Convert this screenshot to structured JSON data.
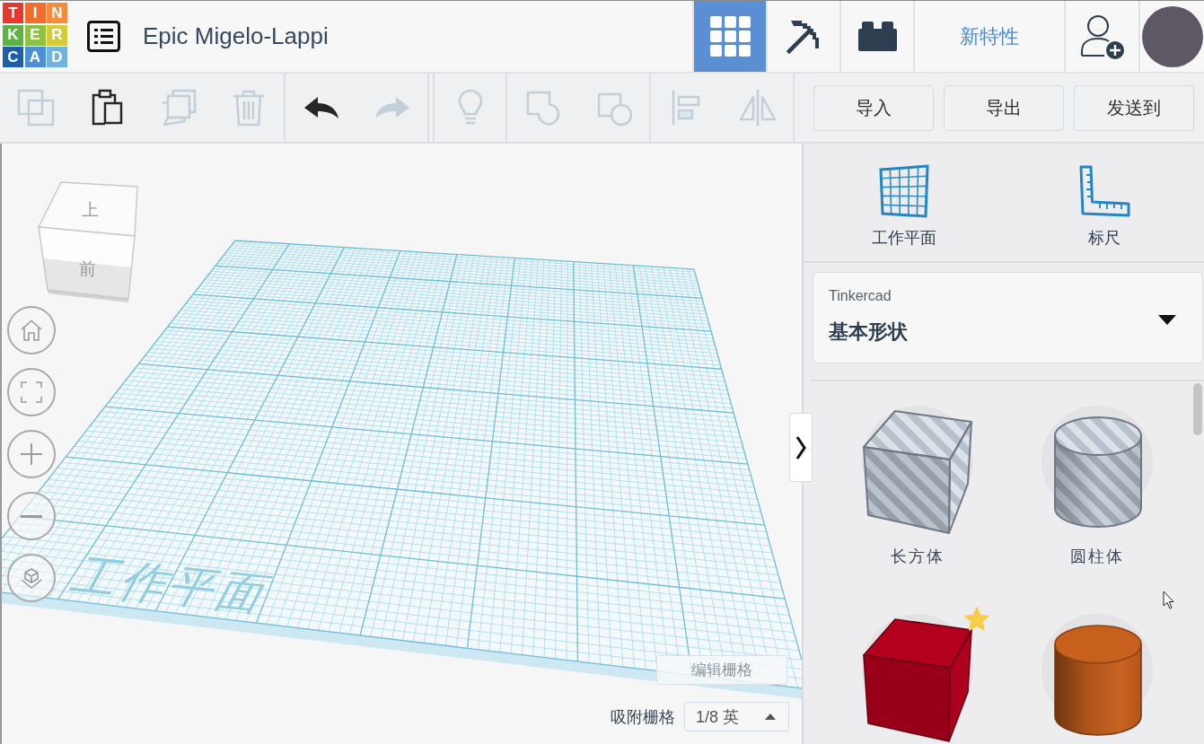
{
  "header": {
    "logo": [
      {
        "letter": "T",
        "color": "#e5372c"
      },
      {
        "letter": "I",
        "color": "#f26d2b"
      },
      {
        "letter": "N",
        "color": "#f68b39"
      },
      {
        "letter": "K",
        "color": "#5fb246"
      },
      {
        "letter": "E",
        "color": "#8fc243"
      },
      {
        "letter": "R",
        "color": "#d4cb3a"
      },
      {
        "letter": "C",
        "color": "#1d5ea9"
      },
      {
        "letter": "A",
        "color": "#4c8fd5"
      },
      {
        "letter": "D",
        "color": "#6fb3e0"
      }
    ],
    "title": "Epic Migelo-Lappi",
    "view_switcher": [
      {
        "selected": true
      },
      {
        "selected": false
      },
      {
        "selected": false
      }
    ],
    "whats_new": "新特性"
  },
  "toolbar": {
    "groups": [
      {
        "buttons": [
          {
            "disabled": true
          },
          {
            "disabled": false
          },
          {
            "disabled": true
          },
          {
            "disabled": true
          }
        ]
      },
      {
        "buttons": [
          {
            "disabled": false
          },
          {
            "disabled": true
          }
        ]
      },
      {
        "buttons": [
          {
            "disabled": true
          }
        ]
      },
      {
        "buttons": [
          {
            "disabled": true
          },
          {
            "disabled": true
          }
        ]
      },
      {
        "buttons": [
          {
            "disabled": true
          },
          {
            "disabled": true
          }
        ]
      }
    ],
    "actions": [
      "导入",
      "导出",
      "发送到"
    ]
  },
  "canvas": {
    "view_cube": {
      "top": "上",
      "front": "前"
    },
    "workplane_label": "工作平面",
    "edit_grid": "编辑栅格",
    "snap_grid": {
      "label": "吸附栅格",
      "value": "1/8 英"
    }
  },
  "panel": {
    "tools": [
      {
        "label": "工作平面"
      },
      {
        "label": "标尺"
      }
    ],
    "library": {
      "label": "Tinkercad",
      "value": "基本形状"
    },
    "shapes": [
      {
        "kind": "box",
        "hole": true,
        "label": "长方体",
        "starred": false
      },
      {
        "kind": "cylinder",
        "hole": true,
        "label": "圆柱体",
        "starred": false
      },
      {
        "kind": "box",
        "hole": false,
        "color": "#b3001f",
        "starred": true
      },
      {
        "kind": "cylinder",
        "hole": false,
        "color": "#c8601d",
        "starred": false
      }
    ]
  }
}
